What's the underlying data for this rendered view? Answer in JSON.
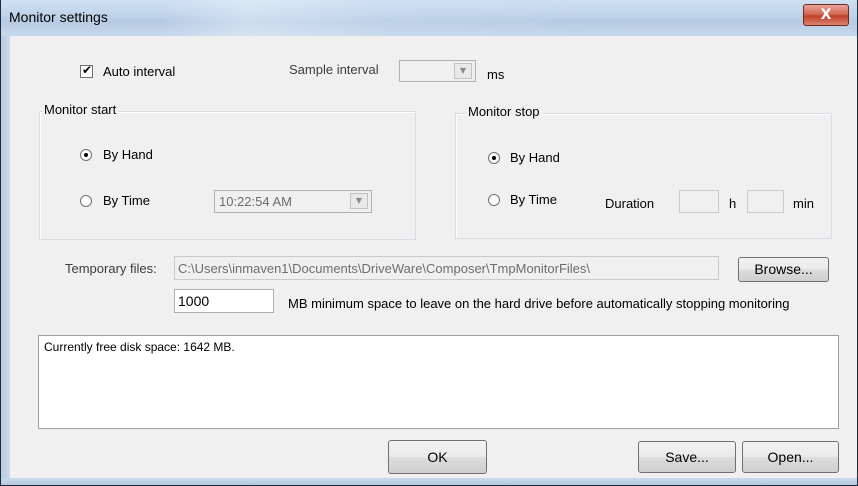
{
  "window": {
    "title": "Monitor settings",
    "close_glyph": "X"
  },
  "auto_interval": {
    "label": "Auto interval",
    "checked": true,
    "check_glyph": "✔"
  },
  "sample_interval": {
    "label": "Sample interval",
    "value": "",
    "unit": "ms"
  },
  "monitor_start": {
    "title": "Monitor start",
    "by_hand_label": "By Hand",
    "by_time_label": "By Time",
    "selected": "By Hand",
    "time_value": "10:22:54 AM"
  },
  "monitor_stop": {
    "title": "Monitor stop",
    "by_hand_label": "By Hand",
    "by_time_label": "By Time",
    "selected": "By Hand",
    "duration_label": "Duration",
    "hours_value": "",
    "hours_unit": "h",
    "minutes_value": "",
    "minutes_unit": "min"
  },
  "temp_files": {
    "label": "Temporary files:",
    "path": "C:\\Users\\inmaven1\\Documents\\DriveWare\\Composer\\TmpMonitorFiles\\",
    "browse_label": "Browse..."
  },
  "min_space": {
    "value": "1000",
    "description": "MB minimum space to leave on the hard drive before automatically stopping monitoring"
  },
  "free_space_text": "Currently free disk space: 1642 MB.",
  "buttons": {
    "ok": "OK",
    "save": "Save...",
    "open": "Open..."
  },
  "icons": {
    "dropdown": "▼"
  }
}
